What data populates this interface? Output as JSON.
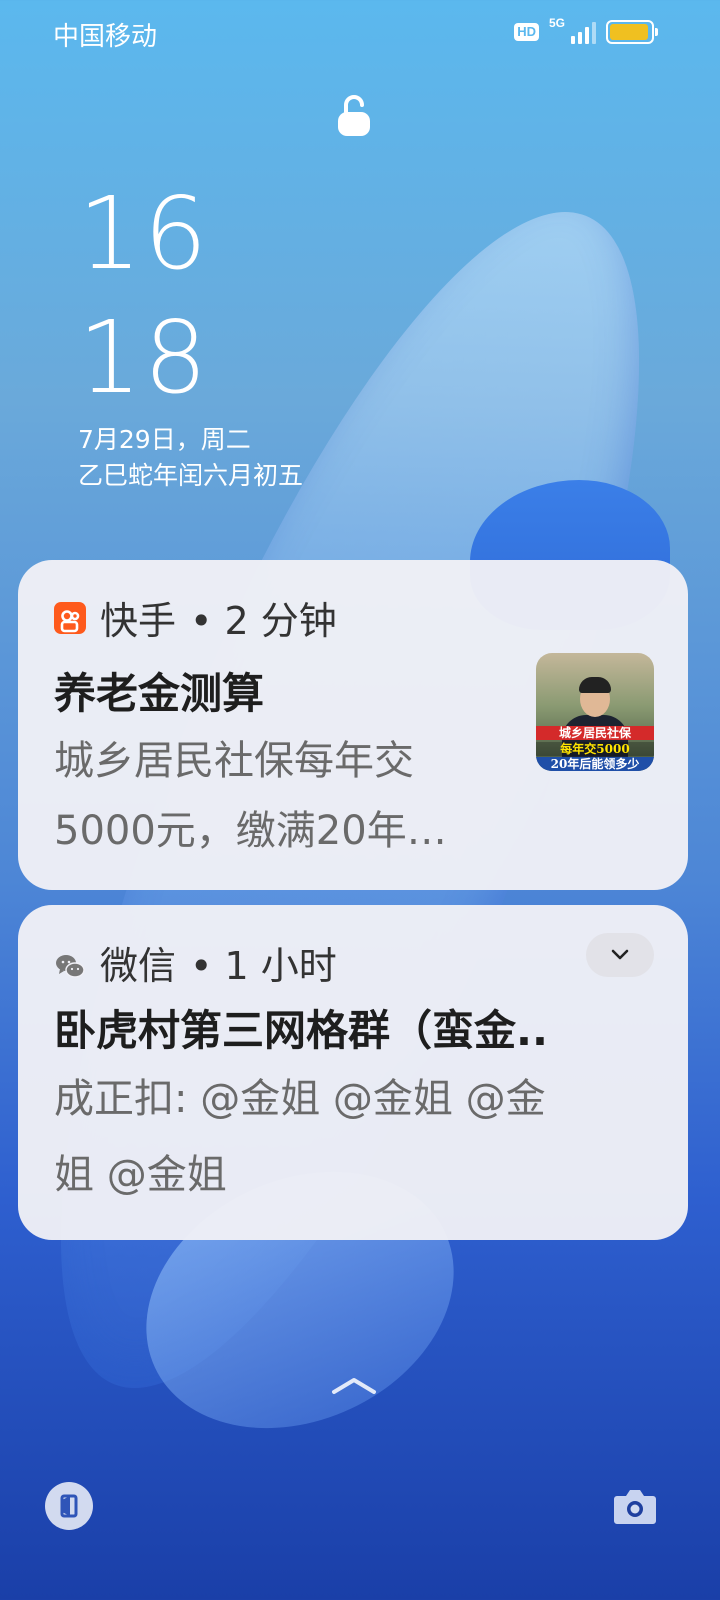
{
  "status_bar": {
    "carrier": "中国移动",
    "hd": "HD",
    "network": "5G",
    "battery_level": 0.95,
    "battery_color": "#f0c020"
  },
  "lockscreen": {
    "hour": "16",
    "minute": "18",
    "date": "7月29日，周二",
    "lunar_date": "乙巳蛇年闰六月初五"
  },
  "notifications": [
    {
      "app": "快手",
      "time": "• 2 分钟",
      "title": "养老金测算",
      "body_line1": "城乡居民社保每年交",
      "body_line2": "5000元，缴满20年…",
      "thumbnail_caption1": "城乡居民社保",
      "thumbnail_caption2": "每年交5000",
      "thumbnail_caption3": "20年后能领多少",
      "icon": "kuaishou-icon",
      "icon_color": "#fe5a1c"
    },
    {
      "app": "微信",
      "time": "• 1 小时",
      "title": "卧虎村第三网格群（蛮金..",
      "body_line1": "成正扣: @金姐 @金姐 @金",
      "body_line2": "姐 @金姐",
      "icon": "wechat-icon"
    }
  ],
  "bottom": {
    "left_icon": "wallet-icon",
    "right_icon": "camera-icon",
    "swipe_icon": "chevron-up-icon"
  }
}
